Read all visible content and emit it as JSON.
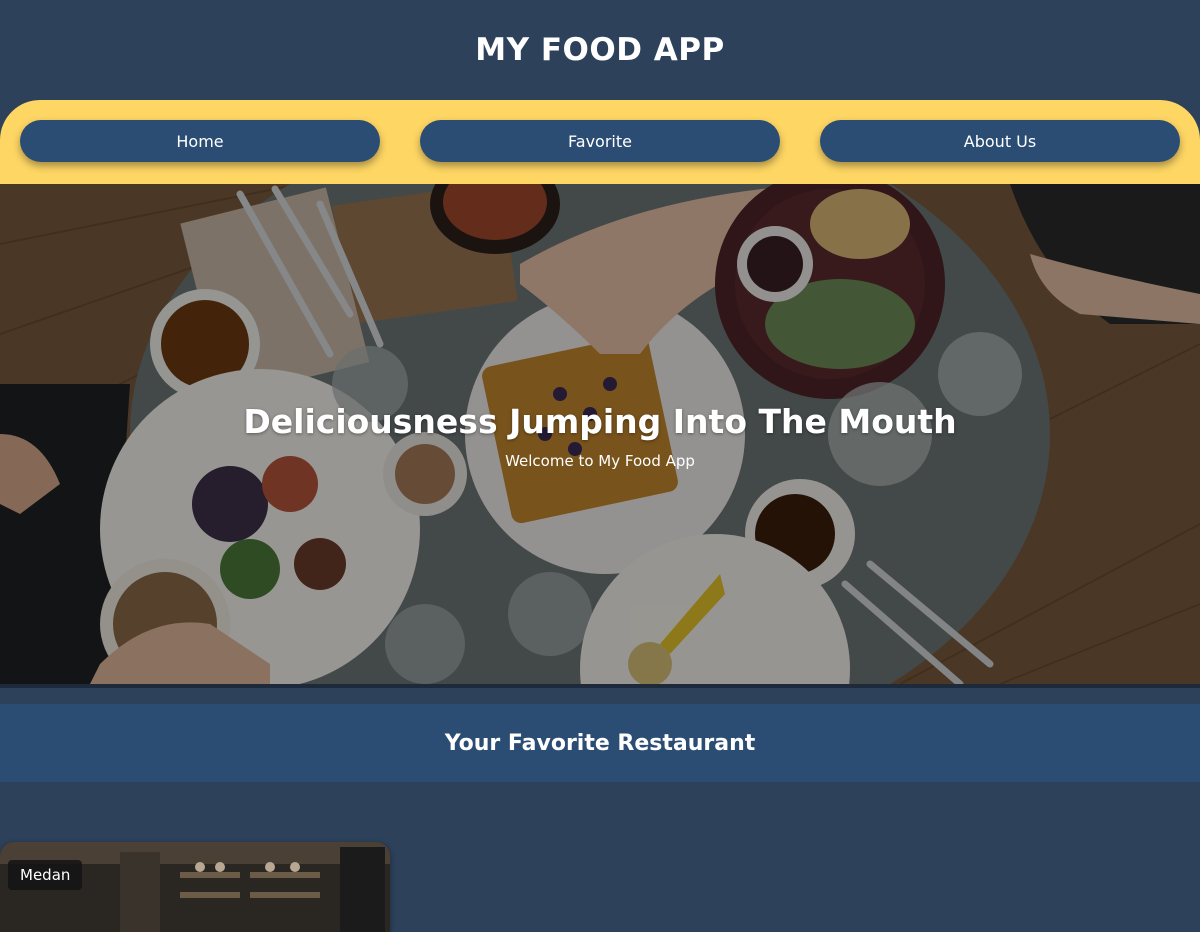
{
  "header": {
    "title": "MY FOOD APP"
  },
  "nav": {
    "items": [
      {
        "label": "Home"
      },
      {
        "label": "Favorite"
      },
      {
        "label": "About Us"
      }
    ]
  },
  "hero": {
    "title": "Deliciousness Jumping Into The Mouth",
    "subtitle": "Welcome to My Food App"
  },
  "section": {
    "title": "Your Favorite Restaurant"
  },
  "restaurants": [
    {
      "city": "Medan"
    }
  ],
  "colors": {
    "page_background": "#2d415a",
    "nav_background": "#fed664",
    "nav_button": "#2b4d73",
    "section_bar": "#2b4d73",
    "text": "#ffffff"
  }
}
